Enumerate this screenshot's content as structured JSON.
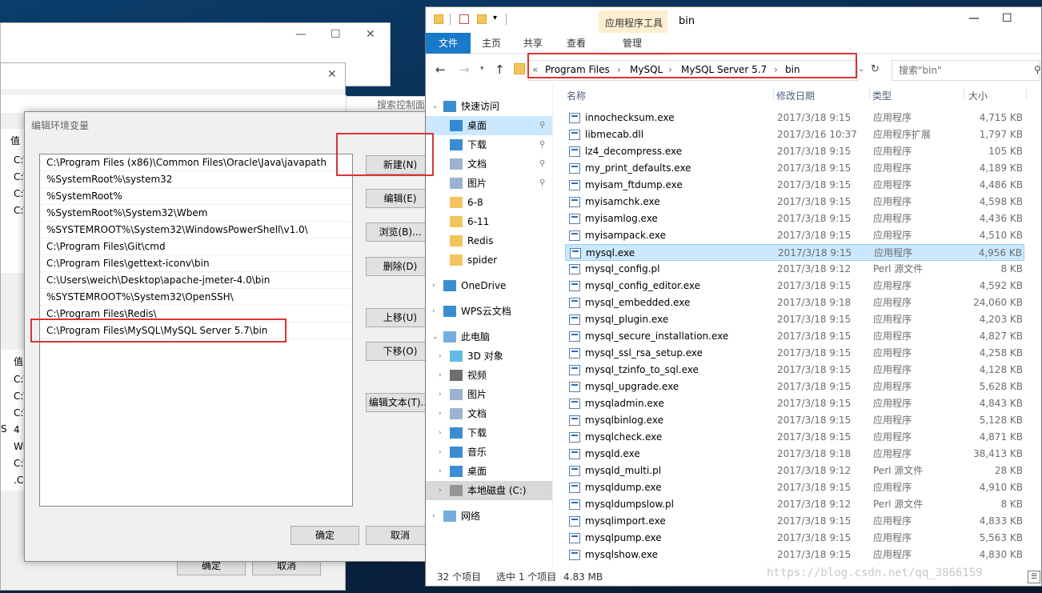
{
  "back_window": {
    "rows_top": [
      "值",
      "C:\\",
      "C:\\",
      "C:\\",
      "C:\\"
    ],
    "rows_bottom": [
      "值",
      "C:\\",
      "C:\\",
      "C:\\",
      "4",
      "Wi",
      "C:\\",
      ".CC"
    ],
    "s_label": "S",
    "search_placeholder": "搜索控制面",
    "ok": "确定",
    "cancel": "取消"
  },
  "dialog": {
    "title": "编辑环境变量",
    "paths": [
      "C:\\Program Files (x86)\\Common Files\\Oracle\\Java\\javapath",
      "%SystemRoot%\\system32",
      "%SystemRoot%",
      "%SystemRoot%\\System32\\Wbem",
      "%SYSTEMROOT%\\System32\\WindowsPowerShell\\v1.0\\",
      "C:\\Program Files\\Git\\cmd",
      "C:\\Program Files\\gettext-iconv\\bin",
      "C:\\Users\\weich\\Desktop\\apache-jmeter-4.0\\bin",
      "%SYSTEMROOT%\\System32\\OpenSSH\\",
      "C:\\Program Files\\Redis\\",
      "C:\\Program Files\\MySQL\\MySQL Server 5.7\\bin"
    ],
    "buttons": {
      "new": "新建(N)",
      "edit": "编辑(E)",
      "browse": "浏览(B)...",
      "delete": "删除(D)",
      "up": "上移(U)",
      "down": "下移(O)",
      "edit_text": "编辑文本(T)...",
      "ok": "确定",
      "cancel": "取消"
    }
  },
  "explorer": {
    "title": "bin",
    "context_tab": "应用程序工具",
    "ribbon_tabs": [
      "文件",
      "主页",
      "共享",
      "查看",
      "管理"
    ],
    "breadcrumb": [
      "Program Files",
      "MySQL",
      "MySQL Server 5.7",
      "bin"
    ],
    "breadcrumb_prefix": "«",
    "search_placeholder": "搜索\"bin\"",
    "columns": [
      "名称",
      "修改日期",
      "类型",
      "大小"
    ],
    "nav": [
      {
        "label": "快速访问",
        "icon": "star-icon",
        "pinned": false
      },
      {
        "label": "桌面",
        "icon": "desktop-icon",
        "pinned": true
      },
      {
        "label": "下载",
        "icon": "download-icon",
        "pinned": true
      },
      {
        "label": "文档",
        "icon": "document-icon",
        "pinned": true
      },
      {
        "label": "图片",
        "icon": "picture-icon",
        "pinned": true
      },
      {
        "label": "6-8",
        "icon": "folder-icon",
        "pinned": false
      },
      {
        "label": "6-11",
        "icon": "folder-icon",
        "pinned": false
      },
      {
        "label": "Redis",
        "icon": "folder-icon",
        "pinned": false
      },
      {
        "label": "spider",
        "icon": "folder-icon",
        "pinned": false
      },
      {
        "label": "OneDrive",
        "icon": "cloud-icon",
        "pinned": false
      },
      {
        "label": "WPS云文档",
        "icon": "cloud-icon",
        "pinned": false
      },
      {
        "label": "此电脑",
        "icon": "computer-icon",
        "pinned": false
      },
      {
        "label": "3D 对象",
        "icon": "cube-icon",
        "pinned": false
      },
      {
        "label": "视频",
        "icon": "video-icon",
        "pinned": false
      },
      {
        "label": "图片",
        "icon": "picture-icon",
        "pinned": false
      },
      {
        "label": "文档",
        "icon": "document-icon",
        "pinned": false
      },
      {
        "label": "下载",
        "icon": "download-icon",
        "pinned": false
      },
      {
        "label": "音乐",
        "icon": "music-icon",
        "pinned": false
      },
      {
        "label": "桌面",
        "icon": "desktop-icon",
        "pinned": false
      },
      {
        "label": "本地磁盘 (C:)",
        "icon": "drive-icon",
        "pinned": false
      },
      {
        "label": "网络",
        "icon": "network-icon",
        "pinned": false
      }
    ],
    "files": [
      {
        "name": "innochecksum.exe",
        "date": "2017/3/18 9:15",
        "type": "应用程序",
        "size": "4,715 KB"
      },
      {
        "name": "libmecab.dll",
        "date": "2017/3/16 10:37",
        "type": "应用程序扩展",
        "size": "1,797 KB"
      },
      {
        "name": "lz4_decompress.exe",
        "date": "2017/3/18 9:15",
        "type": "应用程序",
        "size": "105 KB"
      },
      {
        "name": "my_print_defaults.exe",
        "date": "2017/3/18 9:15",
        "type": "应用程序",
        "size": "4,189 KB"
      },
      {
        "name": "myisam_ftdump.exe",
        "date": "2017/3/18 9:15",
        "type": "应用程序",
        "size": "4,486 KB"
      },
      {
        "name": "myisamchk.exe",
        "date": "2017/3/18 9:15",
        "type": "应用程序",
        "size": "4,598 KB"
      },
      {
        "name": "myisamlog.exe",
        "date": "2017/3/18 9:15",
        "type": "应用程序",
        "size": "4,436 KB"
      },
      {
        "name": "myisampack.exe",
        "date": "2017/3/18 9:15",
        "type": "应用程序",
        "size": "4,510 KB"
      },
      {
        "name": "mysql.exe",
        "date": "2017/3/18 9:15",
        "type": "应用程序",
        "size": "4,956 KB"
      },
      {
        "name": "mysql_config.pl",
        "date": "2017/3/18 9:12",
        "type": "Perl 源文件",
        "size": "8 KB"
      },
      {
        "name": "mysql_config_editor.exe",
        "date": "2017/3/18 9:15",
        "type": "应用程序",
        "size": "4,592 KB"
      },
      {
        "name": "mysql_embedded.exe",
        "date": "2017/3/18 9:18",
        "type": "应用程序",
        "size": "24,060 KB"
      },
      {
        "name": "mysql_plugin.exe",
        "date": "2017/3/18 9:15",
        "type": "应用程序",
        "size": "4,203 KB"
      },
      {
        "name": "mysql_secure_installation.exe",
        "date": "2017/3/18 9:15",
        "type": "应用程序",
        "size": "4,827 KB"
      },
      {
        "name": "mysql_ssl_rsa_setup.exe",
        "date": "2017/3/18 9:15",
        "type": "应用程序",
        "size": "4,258 KB"
      },
      {
        "name": "mysql_tzinfo_to_sql.exe",
        "date": "2017/3/18 9:15",
        "type": "应用程序",
        "size": "4,128 KB"
      },
      {
        "name": "mysql_upgrade.exe",
        "date": "2017/3/18 9:15",
        "type": "应用程序",
        "size": "5,628 KB"
      },
      {
        "name": "mysqladmin.exe",
        "date": "2017/3/18 9:15",
        "type": "应用程序",
        "size": "4,843 KB"
      },
      {
        "name": "mysqlbinlog.exe",
        "date": "2017/3/18 9:15",
        "type": "应用程序",
        "size": "5,128 KB"
      },
      {
        "name": "mysqlcheck.exe",
        "date": "2017/3/18 9:15",
        "type": "应用程序",
        "size": "4,871 KB"
      },
      {
        "name": "mysqld.exe",
        "date": "2017/3/18 9:18",
        "type": "应用程序",
        "size": "38,413 KB"
      },
      {
        "name": "mysqld_multi.pl",
        "date": "2017/3/18 9:12",
        "type": "Perl 源文件",
        "size": "28 KB"
      },
      {
        "name": "mysqldump.exe",
        "date": "2017/3/18 9:15",
        "type": "应用程序",
        "size": "4,910 KB"
      },
      {
        "name": "mysqldumpslow.pl",
        "date": "2017/3/18 9:12",
        "type": "Perl 源文件",
        "size": "8 KB"
      },
      {
        "name": "mysqlimport.exe",
        "date": "2017/3/18 9:15",
        "type": "应用程序",
        "size": "4,833 KB"
      },
      {
        "name": "mysqlpump.exe",
        "date": "2017/3/18 9:15",
        "type": "应用程序",
        "size": "5,563 KB"
      },
      {
        "name": "mysqlshow.exe",
        "date": "2017/3/18 9:15",
        "type": "应用程序",
        "size": "4,830 KB"
      }
    ],
    "status": {
      "count": "32 个项目",
      "selected": "选中 1 个项目",
      "size": "4.83 MB"
    }
  },
  "watermark": "https://blog.csdn.net/qq_3866159",
  "colors": {
    "highlight": "#d93434",
    "selection": "#cce8ff",
    "file_tab": "#1979ca"
  }
}
